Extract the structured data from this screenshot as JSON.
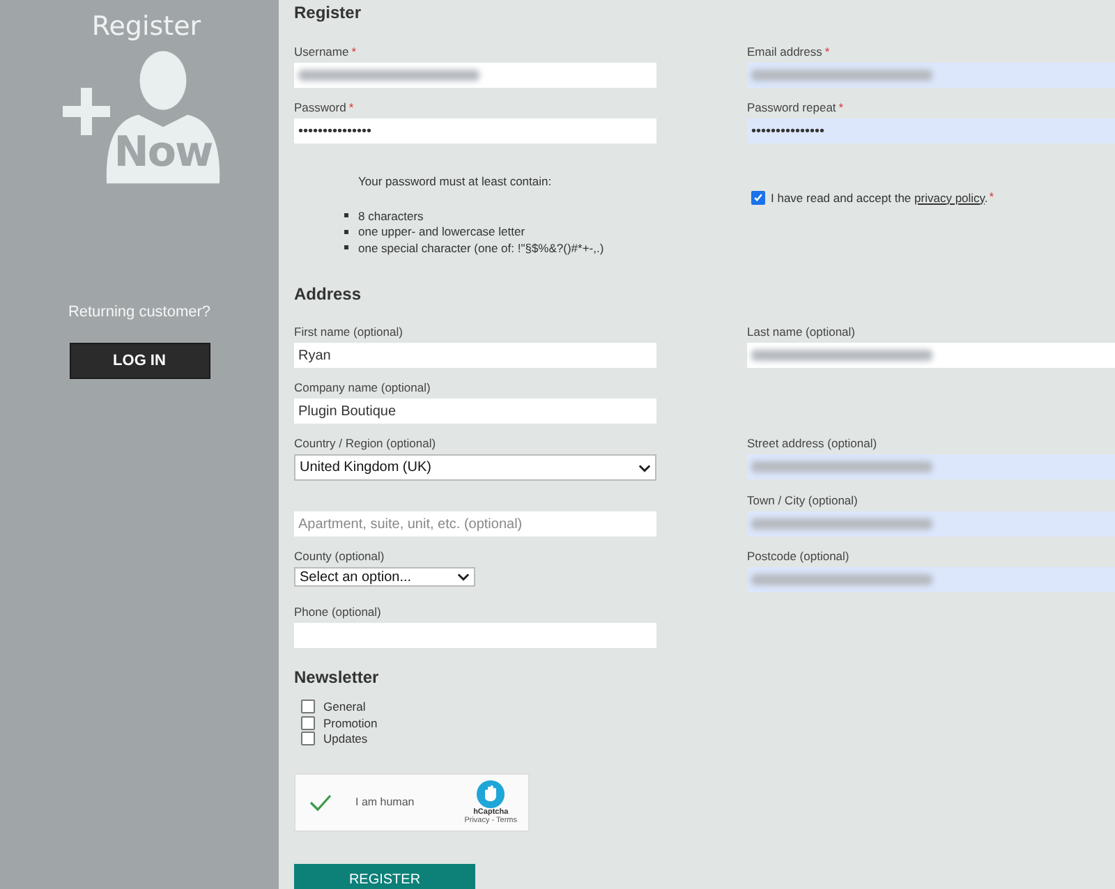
{
  "sidebar": {
    "title": "Register",
    "logo_text": "Now",
    "prompt": "Returning customer?",
    "login_button": "LOG IN"
  },
  "register": {
    "heading": "Register",
    "rows": [
      {
        "left": {
          "kind": "text",
          "label": "Username",
          "required_mark": "*",
          "blurred": true,
          "autofilled": false
        },
        "right": {
          "kind": "text",
          "label": "Email address",
          "required_mark": "*",
          "blurred": true,
          "autofilled": true
        }
      },
      {
        "left": {
          "kind": "text",
          "label": "Password",
          "required_mark": "*",
          "value": "•••••••••••••••",
          "autofilled": false
        },
        "right": {
          "kind": "text",
          "label": "Password repeat",
          "required_mark": "*",
          "value": "•••••••••••••••",
          "autofilled": true
        }
      },
      {
        "left": {
          "kind": "hint",
          "intro": "Your password must at least contain:",
          "items": [
            "8 characters",
            "one upper- and lowercase letter",
            "one special character (one of: !\"§$%&?()#*+-,.)"
          ]
        },
        "right": {
          "kind": "consent",
          "checked": true,
          "text": "I have read and accept the",
          "link": "privacy policy",
          "after": ".",
          "required_mark": "*"
        }
      }
    ]
  },
  "address": {
    "heading": "Address",
    "rows": [
      {
        "left": {
          "kind": "text",
          "label": "First name (optional)",
          "value": "Ryan",
          "autofilled": false
        },
        "right": {
          "kind": "text",
          "label": "Last name (optional)",
          "blurred": true,
          "autofilled": false
        }
      },
      {
        "left": {
          "kind": "text",
          "label": "Company name (optional)",
          "value": "Plugin Boutique",
          "autofilled": false
        }
      },
      {
        "left": {
          "kind": "select",
          "label": "Country / Region (optional)",
          "value": "United Kingdom (UK)"
        },
        "right": {
          "kind": "text",
          "label": "Street address (optional)",
          "blurred": true,
          "autofilled": true
        }
      },
      {
        "left": {
          "kind": "text",
          "placeholder": "Apartment, suite, unit, etc. (optional)",
          "autofilled": false
        },
        "right": {
          "kind": "text",
          "label": "Town / City (optional)",
          "blurred": true,
          "autofilled": true
        }
      },
      {
        "left": {
          "kind": "small-select",
          "label": "County (optional)",
          "value": "Select an option..."
        },
        "right": {
          "kind": "text",
          "label": "Postcode (optional)",
          "blurred": true,
          "autofilled": true
        }
      },
      {
        "left": {
          "kind": "text",
          "label": "Phone (optional)",
          "autofilled": false
        }
      }
    ]
  },
  "newsletter": {
    "heading": "Newsletter",
    "options": [
      {
        "label": "General",
        "checked": false
      },
      {
        "label": "Promotion",
        "checked": false
      },
      {
        "label": "Updates",
        "checked": false
      }
    ]
  },
  "captcha": {
    "checked": true,
    "label": "I am human",
    "brand": "hCaptcha",
    "links": "Privacy - Terms"
  },
  "submit_button": "REGISTER"
}
